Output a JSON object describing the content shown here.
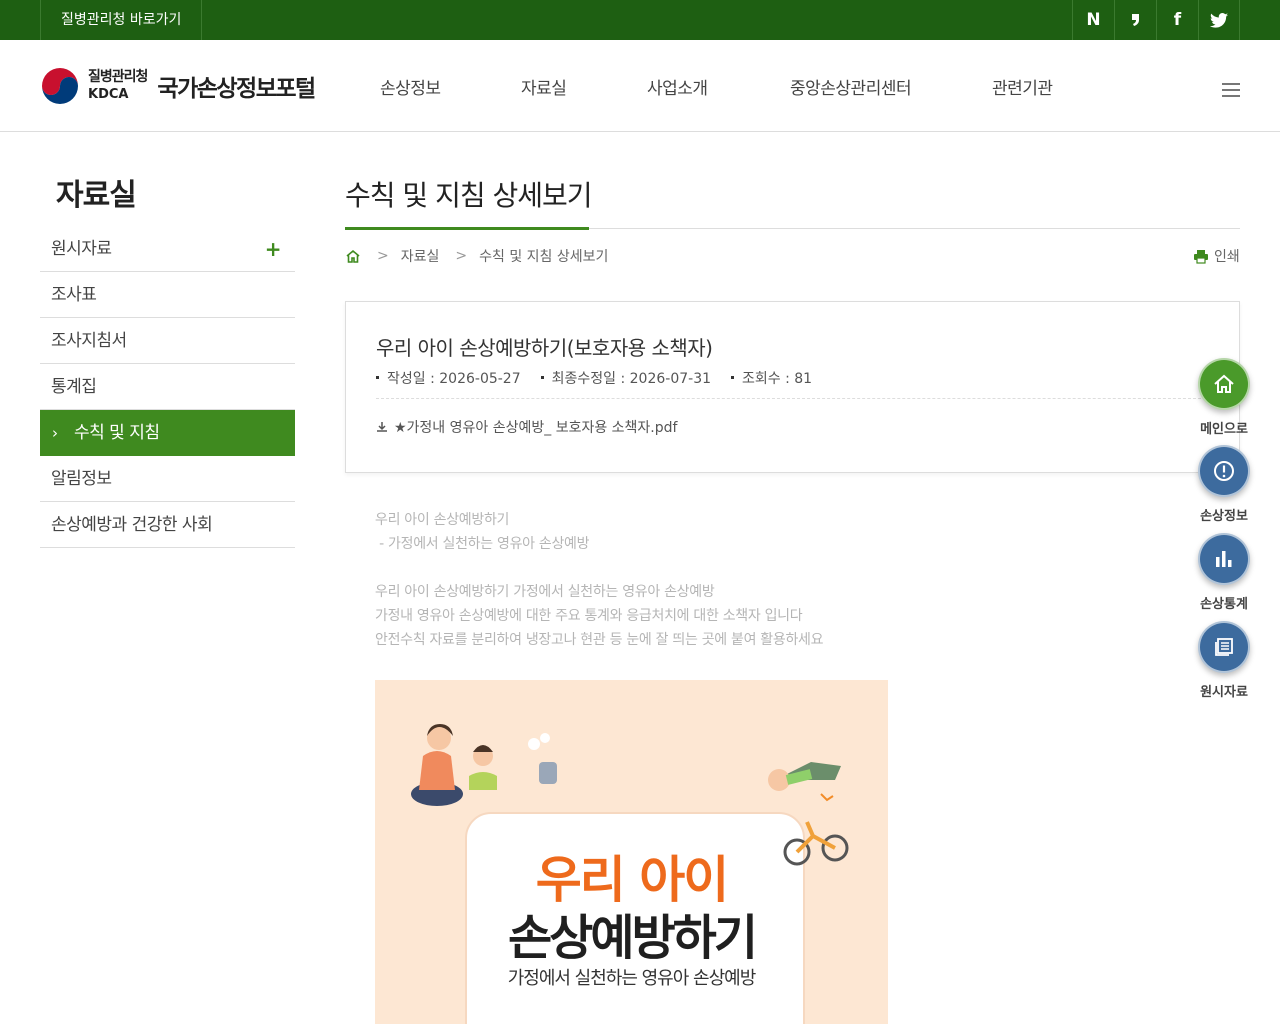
{
  "topbar": {
    "shortcut_label": "질병관리청 바로가기",
    "sns": [
      {
        "icon": "naver-icon",
        "glyph": "N"
      },
      {
        "icon": "blog-icon",
        "glyph": "❟"
      },
      {
        "icon": "facebook-icon",
        "glyph": "f"
      },
      {
        "icon": "twitter-icon",
        "glyph": "🐦"
      }
    ]
  },
  "header": {
    "agency_ko": "질병관리청",
    "agency_en": "KDCA",
    "portal_name": "국가손상정보포털",
    "nav": [
      "손상정보",
      "자료실",
      "사업소개",
      "중앙손상관리센터",
      "관련기관"
    ]
  },
  "sidebar": {
    "title": "자료실",
    "items": [
      {
        "label": "원시자료",
        "expand": "+"
      },
      {
        "label": "조사표"
      },
      {
        "label": "조사지침서"
      },
      {
        "label": "통계집"
      },
      {
        "label": "수칙 및 지침",
        "active": true
      },
      {
        "label": "알림정보"
      },
      {
        "label": "손상예방과 건강한 사회"
      }
    ]
  },
  "content": {
    "title": "수칙 및 지침 상세보기",
    "breadcrumb": [
      "자료실",
      "수칙 및 지침 상세보기"
    ],
    "print_label": "인쇄"
  },
  "post": {
    "title": "우리 아이 손상예방하기(보호자용 소책자)",
    "created": "작성일 : 2026-05-27",
    "modified": "최종수정일 : 2026-07-31",
    "views": "조회수 : 81",
    "attachment": "★가정내 영유아 손상예방_ 보호자용 소책자.pdf",
    "body": [
      "우리 아이 손상예방하기",
      " - 가정에서 실천하는 영유아 손상예방",
      "",
      "우리 아이 손상예방하기 가정에서 실천하는 영유아 손상예방",
      "가정내 영유아 손상예방에 대한 주요 통계와 응급처치에 대한 소책자 입니다",
      "안전수칙 자료를 분리하여 냉장고나 현관 등 눈에 잘 띄는 곳에 붙여 활용하세요"
    ],
    "booklet": {
      "line1": "우리 아이",
      "line2": "손상예방하기",
      "line3": "가정에서 실천하는 영유아 손상예방"
    }
  },
  "quick_menu": [
    {
      "label": "메인으로",
      "icon": "home-icon",
      "color": "#4a9a2a"
    },
    {
      "label": "손상정보",
      "icon": "alert-icon",
      "color": "#3d6b9e"
    },
    {
      "label": "손상통계",
      "icon": "chart-icon",
      "color": "#3d6b9e"
    },
    {
      "label": "원시자료",
      "icon": "document-icon",
      "color": "#3d6b9e"
    }
  ]
}
